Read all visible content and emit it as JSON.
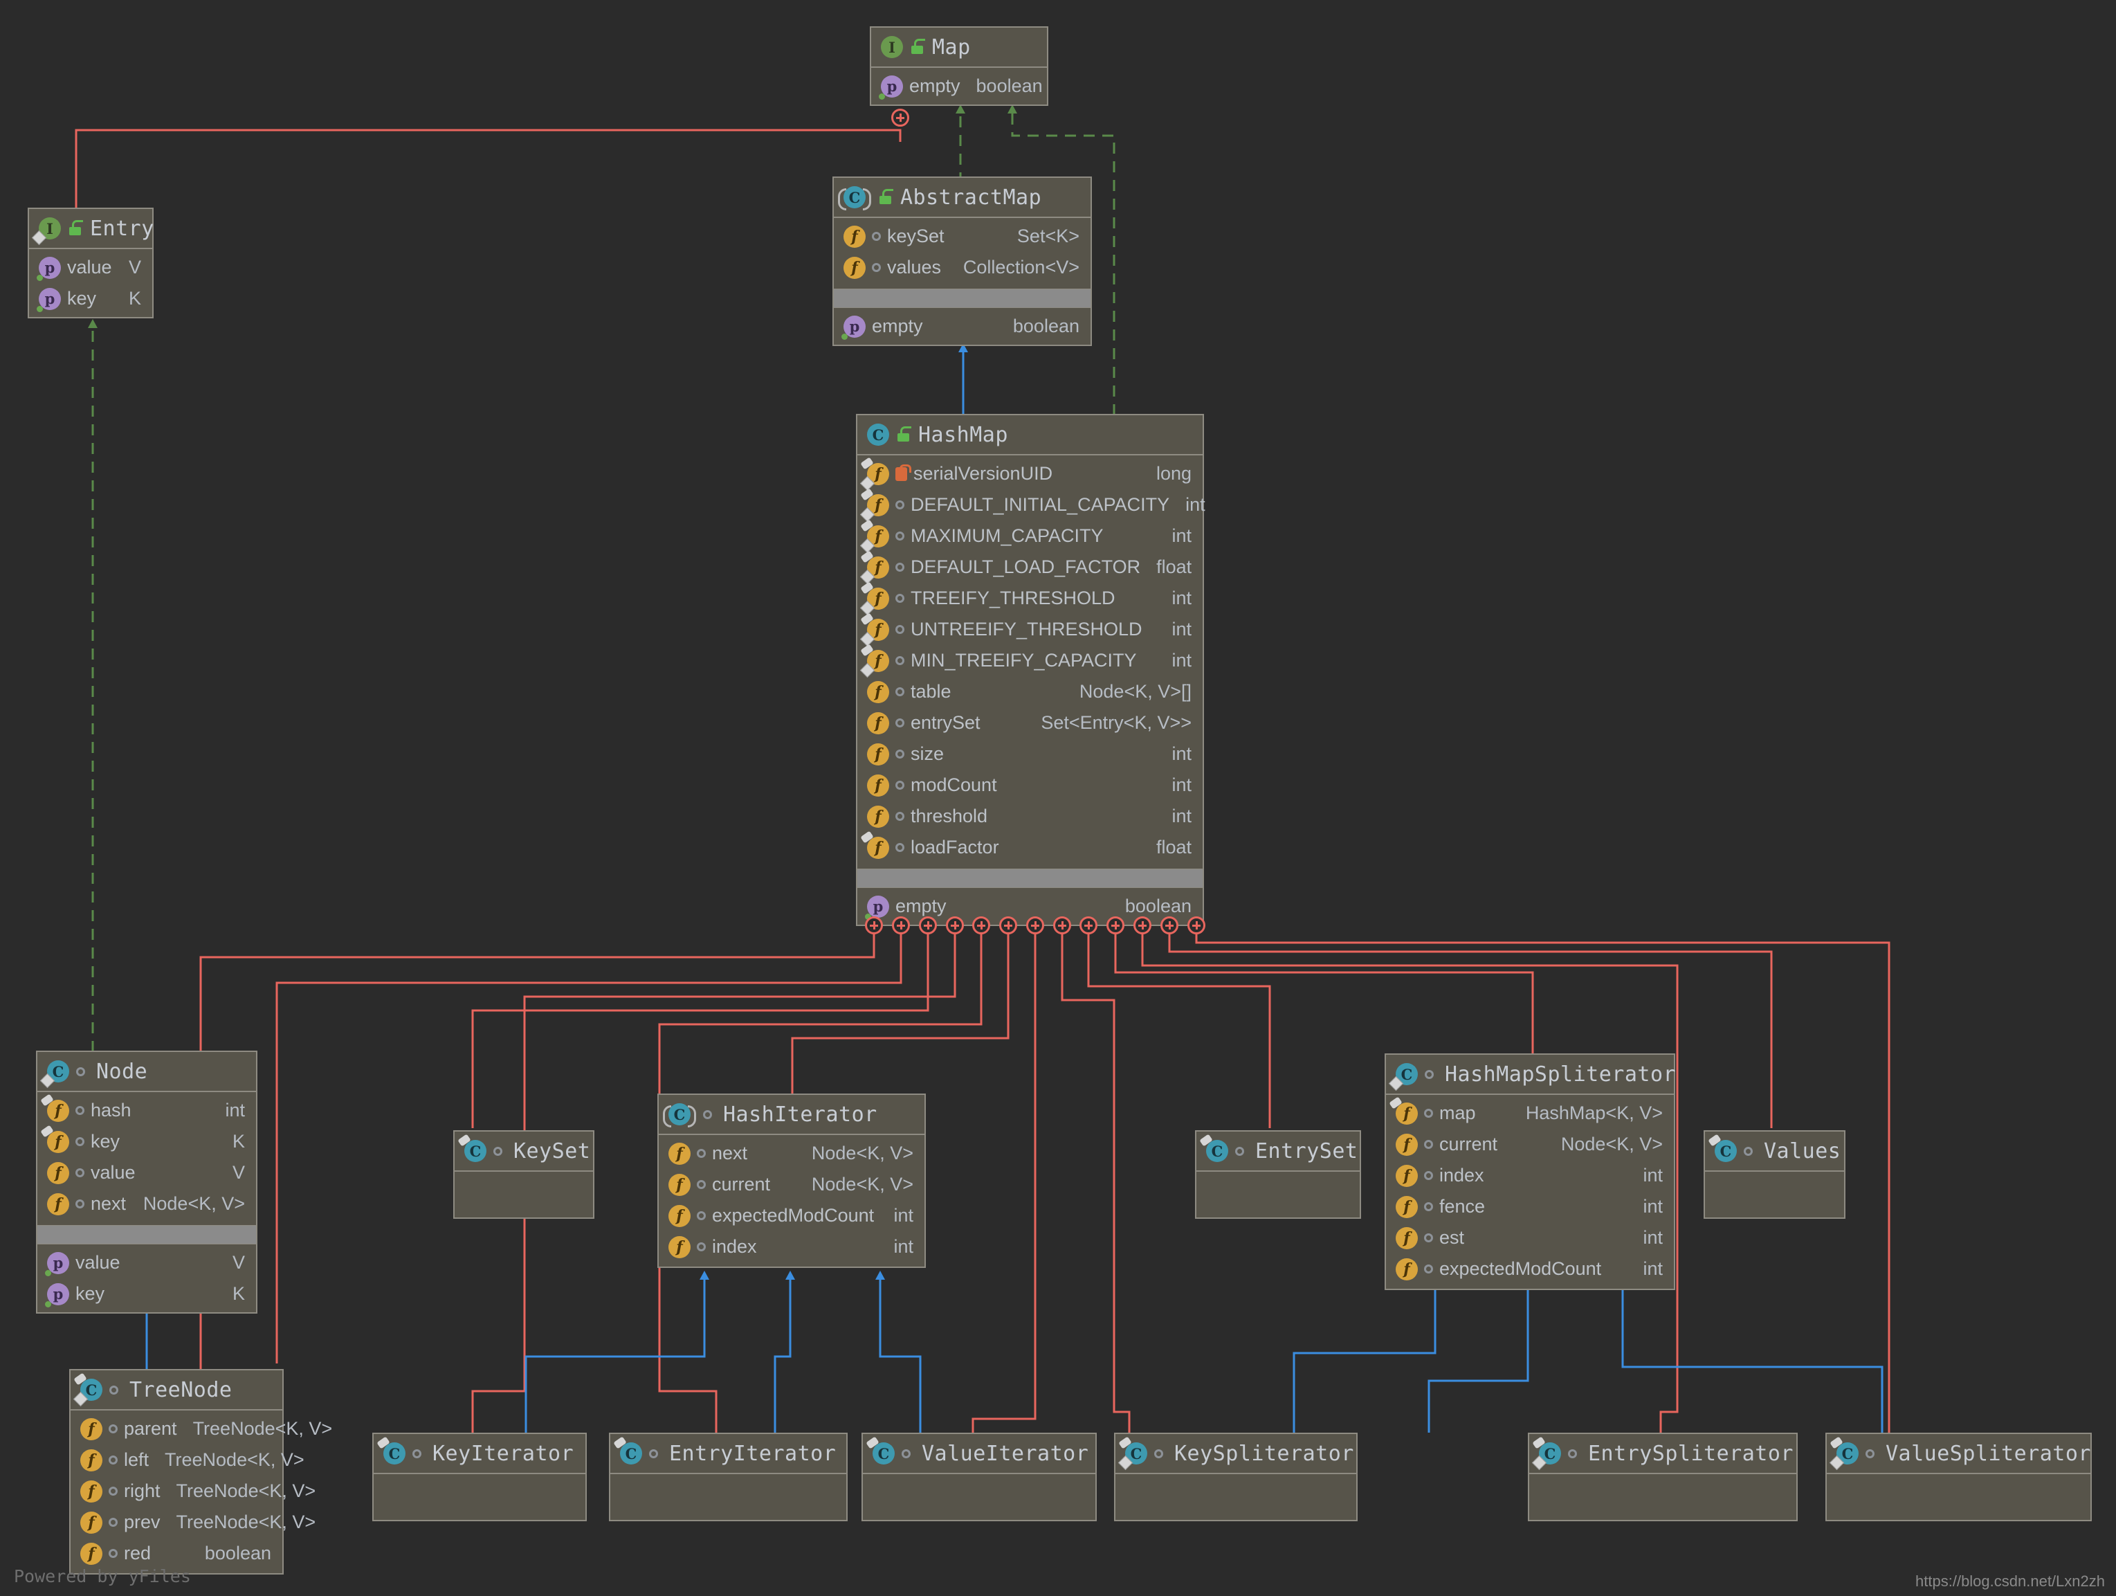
{
  "diagram": {
    "title": "HashMap UML class diagram",
    "background": "#2b2b2b",
    "node_fill": "#57544a",
    "node_border": "#8e8b82",
    "edge_colors": {
      "inner_class": "#e8665e",
      "implements": "#5a8a4a",
      "extends": "#3b8ee0"
    },
    "watermark_left": "Powered by yFiles",
    "watermark_right": "https://blog.csdn.net/Lxn2zh"
  },
  "nodes": [
    {
      "id": "map",
      "name": "Map",
      "kind_icon": "interface-icon",
      "kind_letter": "I",
      "access_icon": "unlocked-public-icon",
      "fields": [],
      "properties": [
        {
          "icon": "property-icon",
          "name": "empty",
          "type": "boolean"
        }
      ]
    },
    {
      "id": "entry",
      "name": "Entry",
      "kind_icon": "interface-icon",
      "kind_letter": "I",
      "access_icon": "unlocked-public-icon",
      "inner": true,
      "fields": [],
      "properties": [
        {
          "icon": "property-icon",
          "name": "value",
          "type": "V"
        },
        {
          "icon": "property-icon",
          "name": "key",
          "type": "K"
        }
      ]
    },
    {
      "id": "abstractmap",
      "name": "AbstractMap",
      "kind_icon": "abstract-class-icon",
      "kind_letter": "C",
      "access_icon": "unlocked-public-icon",
      "abstract": true,
      "fields": [
        {
          "icon": "field-icon",
          "name": "keySet",
          "type": "Set<K>"
        },
        {
          "icon": "field-icon",
          "name": "values",
          "type": "Collection<V>"
        }
      ],
      "properties": [
        {
          "icon": "property-icon",
          "name": "empty",
          "type": "boolean"
        }
      ]
    },
    {
      "id": "hashmap",
      "name": "HashMap",
      "kind_icon": "class-icon",
      "kind_letter": "C",
      "access_icon": "unlocked-public-icon",
      "fields": [
        {
          "icon": "static-field-icon",
          "name": "serialVersionUID",
          "type": "long",
          "access": "private"
        },
        {
          "icon": "static-field-icon",
          "name": "DEFAULT_INITIAL_CAPACITY",
          "type": "int"
        },
        {
          "icon": "static-field-icon",
          "name": "MAXIMUM_CAPACITY",
          "type": "int"
        },
        {
          "icon": "static-field-icon",
          "name": "DEFAULT_LOAD_FACTOR",
          "type": "float"
        },
        {
          "icon": "static-field-icon",
          "name": "TREEIFY_THRESHOLD",
          "type": "int"
        },
        {
          "icon": "static-field-icon",
          "name": "UNTREEIFY_THRESHOLD",
          "type": "int"
        },
        {
          "icon": "static-field-icon",
          "name": "MIN_TREEIFY_CAPACITY",
          "type": "int"
        },
        {
          "icon": "field-icon",
          "name": "table",
          "type": "Node<K, V>[]"
        },
        {
          "icon": "field-icon",
          "name": "entrySet",
          "type": "Set<Entry<K, V>>"
        },
        {
          "icon": "field-icon",
          "name": "size",
          "type": "int"
        },
        {
          "icon": "field-icon",
          "name": "modCount",
          "type": "int"
        },
        {
          "icon": "field-icon",
          "name": "threshold",
          "type": "int"
        },
        {
          "icon": "transient-field-icon",
          "name": "loadFactor",
          "type": "float"
        }
      ],
      "properties": [
        {
          "icon": "property-icon",
          "name": "empty",
          "type": "boolean"
        }
      ]
    },
    {
      "id": "node",
      "name": "Node",
      "kind_icon": "inner-class-icon",
      "kind_letter": "C",
      "access_icon": "package-private-icon",
      "fields": [
        {
          "icon": "transient-field-icon",
          "name": "hash",
          "type": "int"
        },
        {
          "icon": "transient-field-icon",
          "name": "key",
          "type": "K"
        },
        {
          "icon": "field-icon",
          "name": "value",
          "type": "V"
        },
        {
          "icon": "field-icon",
          "name": "next",
          "type": "Node<K, V>"
        }
      ],
      "properties": [
        {
          "icon": "property-icon",
          "name": "value",
          "type": "V"
        },
        {
          "icon": "property-icon",
          "name": "key",
          "type": "K"
        }
      ]
    },
    {
      "id": "treenode",
      "name": "TreeNode",
      "kind_icon": "inner-class-icon",
      "kind_letter": "C",
      "access_icon": "package-private-icon",
      "fields": [
        {
          "icon": "field-icon",
          "name": "parent",
          "type": "TreeNode<K, V>"
        },
        {
          "icon": "field-icon",
          "name": "left",
          "type": "TreeNode<K, V>"
        },
        {
          "icon": "field-icon",
          "name": "right",
          "type": "TreeNode<K, V>"
        },
        {
          "icon": "field-icon",
          "name": "prev",
          "type": "TreeNode<K, V>"
        },
        {
          "icon": "field-icon",
          "name": "red",
          "type": "boolean"
        }
      ],
      "properties": []
    },
    {
      "id": "keyset",
      "name": "KeySet",
      "kind_icon": "inner-class-icon",
      "kind_letter": "C",
      "access_icon": "package-private-icon",
      "fields": [],
      "properties": []
    },
    {
      "id": "hashiterator",
      "name": "HashIterator",
      "kind_icon": "abstract-class-icon",
      "kind_letter": "C",
      "access_icon": "package-private-icon",
      "abstract": true,
      "fields": [
        {
          "icon": "field-icon",
          "name": "next",
          "type": "Node<K, V>"
        },
        {
          "icon": "field-icon",
          "name": "current",
          "type": "Node<K, V>"
        },
        {
          "icon": "field-icon",
          "name": "expectedModCount",
          "type": "int"
        },
        {
          "icon": "field-icon",
          "name": "index",
          "type": "int"
        }
      ],
      "properties": []
    },
    {
      "id": "entryset",
      "name": "EntrySet",
      "kind_icon": "inner-class-icon",
      "kind_letter": "C",
      "access_icon": "package-private-icon",
      "fields": [],
      "properties": []
    },
    {
      "id": "hashmapspliterator",
      "name": "HashMapSpliterator",
      "kind_icon": "inner-class-icon",
      "kind_letter": "C",
      "access_icon": "package-private-icon",
      "fields": [
        {
          "icon": "transient-field-icon",
          "name": "map",
          "type": "HashMap<K, V>"
        },
        {
          "icon": "field-icon",
          "name": "current",
          "type": "Node<K, V>"
        },
        {
          "icon": "field-icon",
          "name": "index",
          "type": "int"
        },
        {
          "icon": "field-icon",
          "name": "fence",
          "type": "int"
        },
        {
          "icon": "field-icon",
          "name": "est",
          "type": "int"
        },
        {
          "icon": "field-icon",
          "name": "expectedModCount",
          "type": "int"
        }
      ],
      "properties": []
    },
    {
      "id": "values",
      "name": "Values",
      "kind_icon": "inner-class-icon",
      "kind_letter": "C",
      "access_icon": "package-private-icon",
      "fields": [],
      "properties": []
    },
    {
      "id": "keyiterator",
      "name": "KeyIterator",
      "kind_icon": "inner-class-icon",
      "kind_letter": "C",
      "access_icon": "package-private-icon",
      "fields": [],
      "properties": []
    },
    {
      "id": "entryiterator",
      "name": "EntryIterator",
      "kind_icon": "inner-class-icon",
      "kind_letter": "C",
      "access_icon": "package-private-icon",
      "fields": [],
      "properties": []
    },
    {
      "id": "valueiterator",
      "name": "ValueIterator",
      "kind_icon": "inner-class-icon",
      "kind_letter": "C",
      "access_icon": "package-private-icon",
      "fields": [],
      "properties": []
    },
    {
      "id": "keyspliterator",
      "name": "KeySpliterator",
      "kind_icon": "inner-class-icon",
      "kind_letter": "C",
      "access_icon": "package-private-icon",
      "fields": [],
      "properties": []
    },
    {
      "id": "entryspliterator",
      "name": "EntrySpliterator",
      "kind_icon": "inner-class-icon",
      "kind_letter": "C",
      "access_icon": "package-private-icon",
      "fields": [],
      "properties": []
    },
    {
      "id": "valuespliterator",
      "name": "ValueSpliterator",
      "kind_icon": "inner-class-icon",
      "kind_letter": "C",
      "access_icon": "package-private-icon",
      "fields": [],
      "properties": []
    }
  ]
}
